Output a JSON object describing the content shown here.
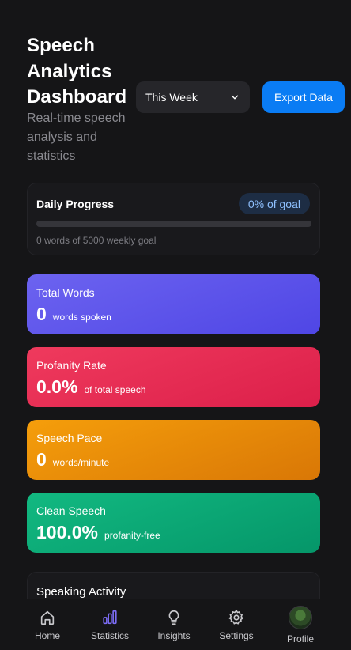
{
  "header": {
    "title": "Speech Analytics Dashboard",
    "subtitle": "Real-time speech analysis and statistics"
  },
  "controls": {
    "period_value": "This Week",
    "export_label": "Export Data"
  },
  "progress": {
    "title": "Daily Progress",
    "badge": "0% of goal",
    "percent": 0,
    "note": "0 words of 5000 weekly goal"
  },
  "stats": [
    {
      "label": "Total Words",
      "value": "0",
      "unit": "words spoken"
    },
    {
      "label": "Profanity Rate",
      "value": "0.0%",
      "unit": "of total speech"
    },
    {
      "label": "Speech Pace",
      "value": "0",
      "unit": "words/minute"
    },
    {
      "label": "Clean Speech",
      "value": "100.0%",
      "unit": "profanity-free"
    }
  ],
  "activity": {
    "title": "Speaking Activity"
  },
  "nav": {
    "items": [
      {
        "label": "Home",
        "icon": "home-icon"
      },
      {
        "label": "Statistics",
        "icon": "bar-chart-icon"
      },
      {
        "label": "Insights",
        "icon": "lightbulb-icon"
      },
      {
        "label": "Settings",
        "icon": "gear-icon"
      },
      {
        "label": "Profile",
        "icon": "avatar"
      }
    ],
    "active_color": "#7c6cf5"
  }
}
